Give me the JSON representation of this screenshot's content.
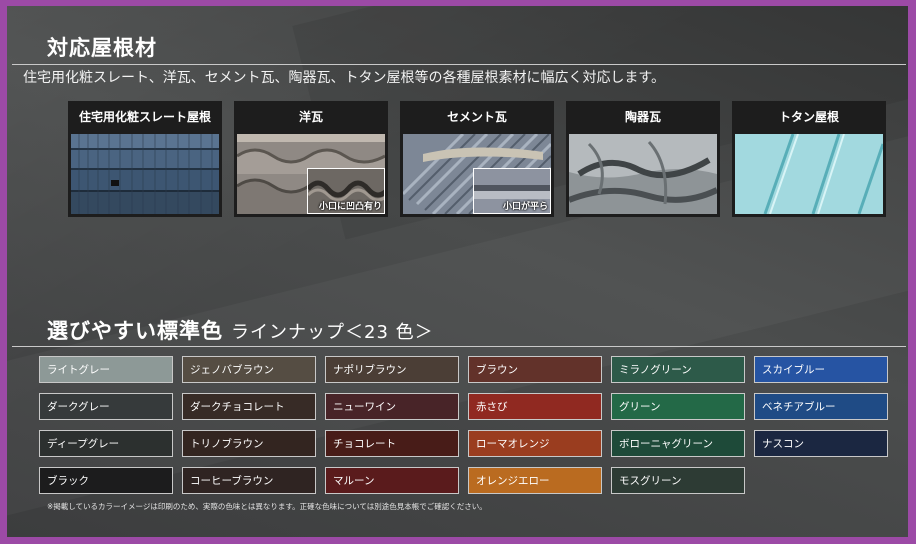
{
  "section1": {
    "title": "対応屋根材",
    "subtitle": "住宅用化粧スレート、洋瓦、セメント瓦、陶器瓦、トタン屋根等の各種屋根素材に幅広く対応します。"
  },
  "roofs": [
    {
      "label": "住宅用化粧スレート屋根",
      "inset_caption": ""
    },
    {
      "label": "洋瓦",
      "inset_caption": "小口に凹凸有り"
    },
    {
      "label": "セメント瓦",
      "inset_caption": "小口が平ら"
    },
    {
      "label": "陶器瓦",
      "inset_caption": ""
    },
    {
      "label": "トタン屋根",
      "inset_caption": ""
    }
  ],
  "section2": {
    "title": "選びやすい標準色",
    "title_small": "ラインナップ＜23 色＞"
  },
  "swatches": [
    {
      "label": "ライトグレー",
      "color": "#8d9997"
    },
    {
      "label": "ジェノバブラウン",
      "color": "#554d43"
    },
    {
      "label": "ナポリブラウン",
      "color": "#4b3e36"
    },
    {
      "label": "ブラウン",
      "color": "#62322a"
    },
    {
      "label": "ミラノグリーン",
      "color": "#2d5a49"
    },
    {
      "label": "スカイブルー",
      "color": "#2654a3"
    },
    {
      "label": "ダークグレー",
      "color": "#363a3b"
    },
    {
      "label": "ダークチョコレート",
      "color": "#372b26"
    },
    {
      "label": "ニューワイン",
      "color": "#482428"
    },
    {
      "label": "赤さび",
      "color": "#902921"
    },
    {
      "label": "グリーン",
      "color": "#236947"
    },
    {
      "label": "ベネチアブルー",
      "color": "#1f4b85"
    },
    {
      "label": "ディープグレー",
      "color": "#2c302f"
    },
    {
      "label": "トリノブラウン",
      "color": "#332520"
    },
    {
      "label": "チョコレート",
      "color": "#481c18"
    },
    {
      "label": "ローマオレンジ",
      "color": "#9a3d1f"
    },
    {
      "label": "ボローニャグリーン",
      "color": "#1e4a39"
    },
    {
      "label": "ナスコン",
      "color": "#1b2741"
    },
    {
      "label": "ブラック",
      "color": "#1c1c1d"
    },
    {
      "label": "コーヒーブラウン",
      "color": "#2f2422"
    },
    {
      "label": "マルーン",
      "color": "#5a1b1c"
    },
    {
      "label": "オレンジエロー",
      "color": "#ba6b20"
    },
    {
      "label": "モスグリーン",
      "color": "#2d3b34"
    }
  ],
  "note": "※掲載しているカラーイメージは印刷のため、実際の色味とは異なります。正確な色味については別途色見本帳でご確認ください。"
}
